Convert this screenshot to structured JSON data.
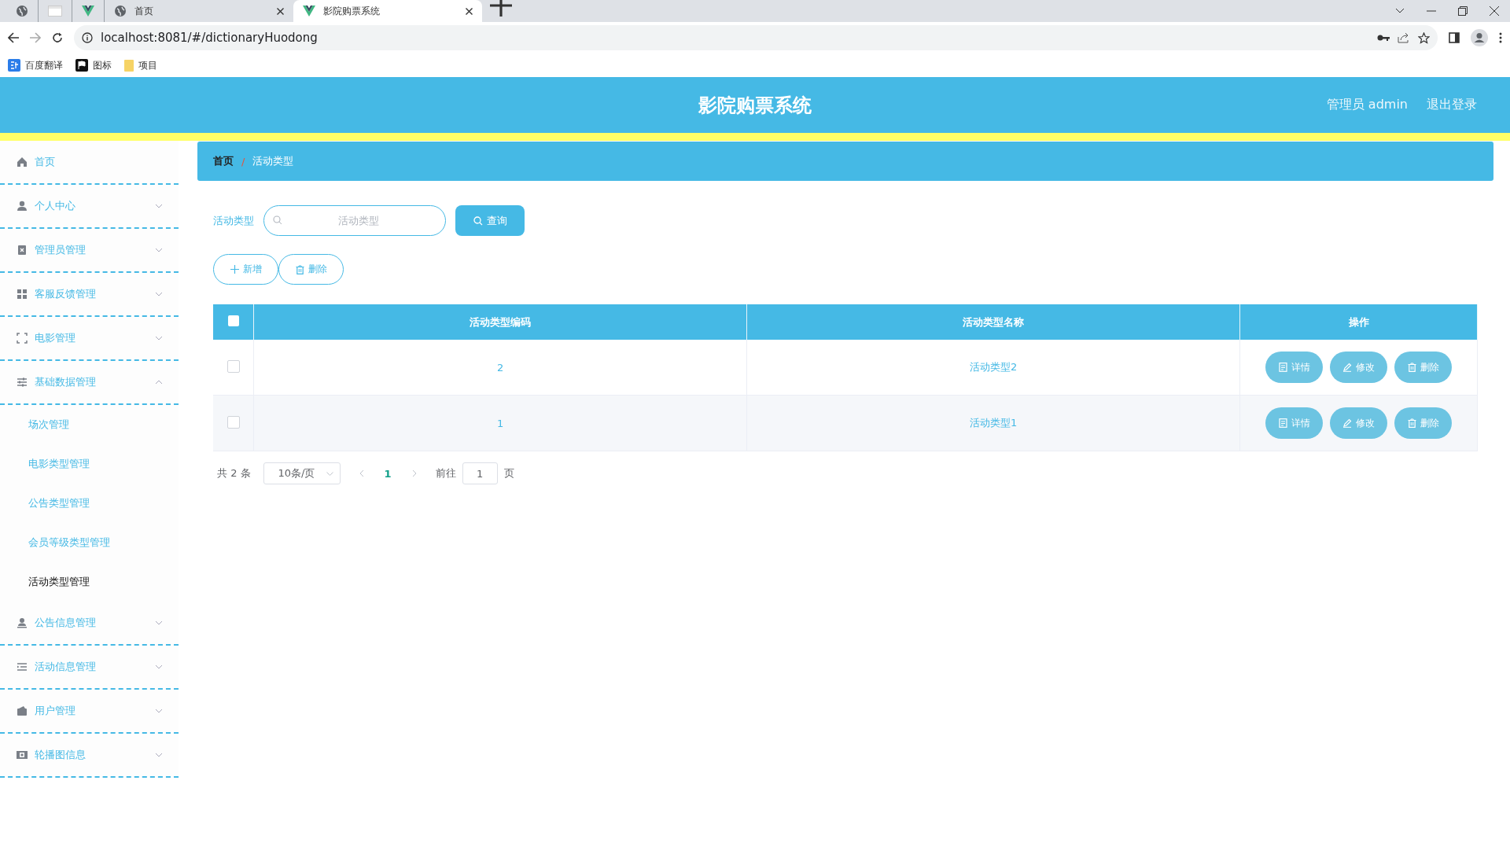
{
  "browser": {
    "tabs": [
      {
        "kind": "pinned",
        "selected": false
      },
      {
        "kind": "pinned-blank",
        "selected": false
      },
      {
        "kind": "pinned-v",
        "selected": false
      },
      {
        "kind": "page",
        "title": "首页",
        "selected": false
      },
      {
        "kind": "page-v",
        "title": "影院购票系统",
        "selected": true
      }
    ],
    "url": "localhost:8081/#/dictionaryHuodong",
    "bookmarks": [
      {
        "kind": "translate",
        "label": "百度翻译"
      },
      {
        "kind": "flag",
        "label": "图标"
      },
      {
        "kind": "folder",
        "label": "项目"
      }
    ]
  },
  "header": {
    "title": "影院购票系统",
    "user": "管理员 admin",
    "logout": "退出登录"
  },
  "sidebar": {
    "items": [
      {
        "kind": "link",
        "label": "首页"
      },
      {
        "kind": "menu",
        "label": "个人中心",
        "expanded": false
      },
      {
        "kind": "menu",
        "label": "管理员管理",
        "expanded": false
      },
      {
        "kind": "menu",
        "label": "客服反馈管理",
        "expanded": false
      },
      {
        "kind": "menu",
        "label": "电影管理",
        "expanded": false
      },
      {
        "kind": "menu",
        "label": "基础数据管理",
        "expanded": true,
        "children": [
          {
            "label": "场次管理",
            "selected": false
          },
          {
            "label": "电影类型管理",
            "selected": false
          },
          {
            "label": "公告类型管理",
            "selected": false
          },
          {
            "label": "会员等级类型管理",
            "selected": false
          },
          {
            "label": "活动类型管理",
            "selected": true
          }
        ]
      },
      {
        "kind": "menu",
        "label": "公告信息管理",
        "expanded": false
      },
      {
        "kind": "menu",
        "label": "活动信息管理",
        "expanded": false
      },
      {
        "kind": "menu",
        "label": "用户管理",
        "expanded": false
      },
      {
        "kind": "menu",
        "label": "轮播图信息",
        "expanded": false
      }
    ]
  },
  "breadcrumb": [
    "首页",
    "/",
    "活动类型"
  ],
  "search": {
    "label": "活动类型",
    "placeholder": "活动类型",
    "button": "查询"
  },
  "actions": [
    {
      "kind": "add",
      "label": "新增"
    },
    {
      "kind": "delete",
      "label": "删除"
    }
  ],
  "table": {
    "all_checked": false,
    "columns": [
      "活动类型编码",
      "活动类型名称",
      "操作"
    ],
    "rows": [
      {
        "checked": false,
        "cells": [
          "2",
          "活动类型2"
        ],
        "buttons": [
          {
            "kind": "detail",
            "label": "详情"
          },
          {
            "kind": "edit",
            "label": "修改"
          },
          {
            "kind": "delete",
            "label": "删除"
          }
        ]
      },
      {
        "checked": false,
        "cells": [
          "1",
          "活动类型1"
        ],
        "buttons": [
          {
            "kind": "detail",
            "label": "详情"
          },
          {
            "kind": "edit",
            "label": "修改"
          },
          {
            "kind": "delete",
            "label": "删除"
          }
        ]
      }
    ]
  },
  "pagination": {
    "total": "共 2 条",
    "page_size": "10条/页",
    "pages": [
      {
        "label": "1",
        "selected": true
      }
    ],
    "goto": "前往",
    "goto_value": "1",
    "goto_suffix": "页"
  }
}
